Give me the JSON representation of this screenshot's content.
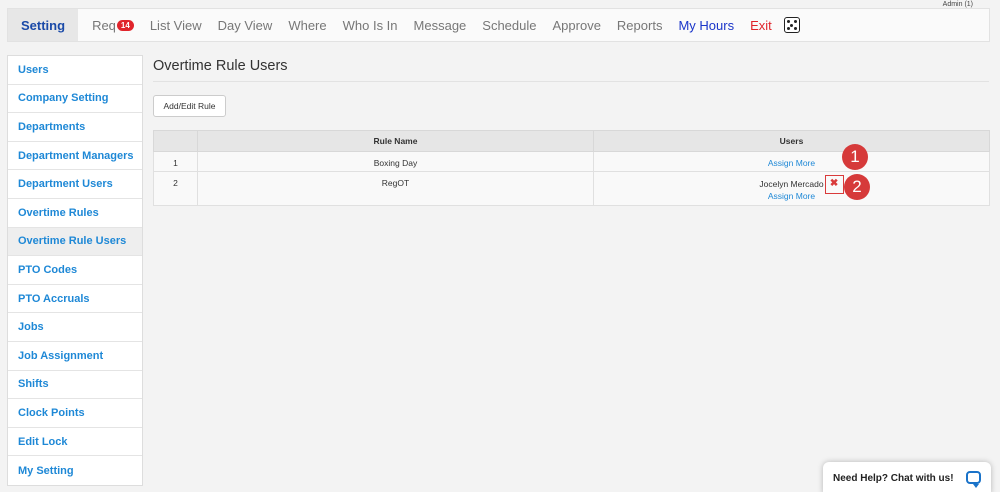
{
  "header": {
    "admin_label": "Admin (1)"
  },
  "topnav": {
    "setting": "Setting",
    "req": "Req",
    "req_badge": "14",
    "list_view": "List View",
    "day_view": "Day View",
    "where": "Where",
    "who_is_in": "Who Is In",
    "message": "Message",
    "schedule": "Schedule",
    "approve": "Approve",
    "reports": "Reports",
    "my_hours": "My Hours",
    "exit": "Exit",
    "extra_icon": "dice-icon"
  },
  "sidebar": {
    "items": [
      "Users",
      "Company Setting",
      "Departments",
      "Department Managers",
      "Department Users",
      "Overtime Rules",
      "Overtime Rule Users",
      "PTO Codes",
      "PTO Accruals",
      "Jobs",
      "Job Assignment",
      "Shifts",
      "Clock Points",
      "Edit Lock",
      "My Setting"
    ],
    "active": "Overtime Rule Users"
  },
  "main": {
    "title": "Overtime Rule Users",
    "add_button": "Add/Edit Rule",
    "table": {
      "headers": [
        "",
        "Rule Name",
        "Users"
      ],
      "rows": [
        {
          "num": "1",
          "rule": "Boxing Day",
          "users": [],
          "assign": "Assign More"
        },
        {
          "num": "2",
          "rule": "RegOT",
          "users": [
            "Jocelyn Mercado"
          ],
          "assign": "Assign More"
        }
      ]
    }
  },
  "callouts": [
    "1",
    "2"
  ],
  "chat": {
    "label": "Need Help? Chat with us!"
  },
  "colors": {
    "accent": "#1e88d6",
    "danger": "#e0242b",
    "callout": "#d63a3a"
  }
}
